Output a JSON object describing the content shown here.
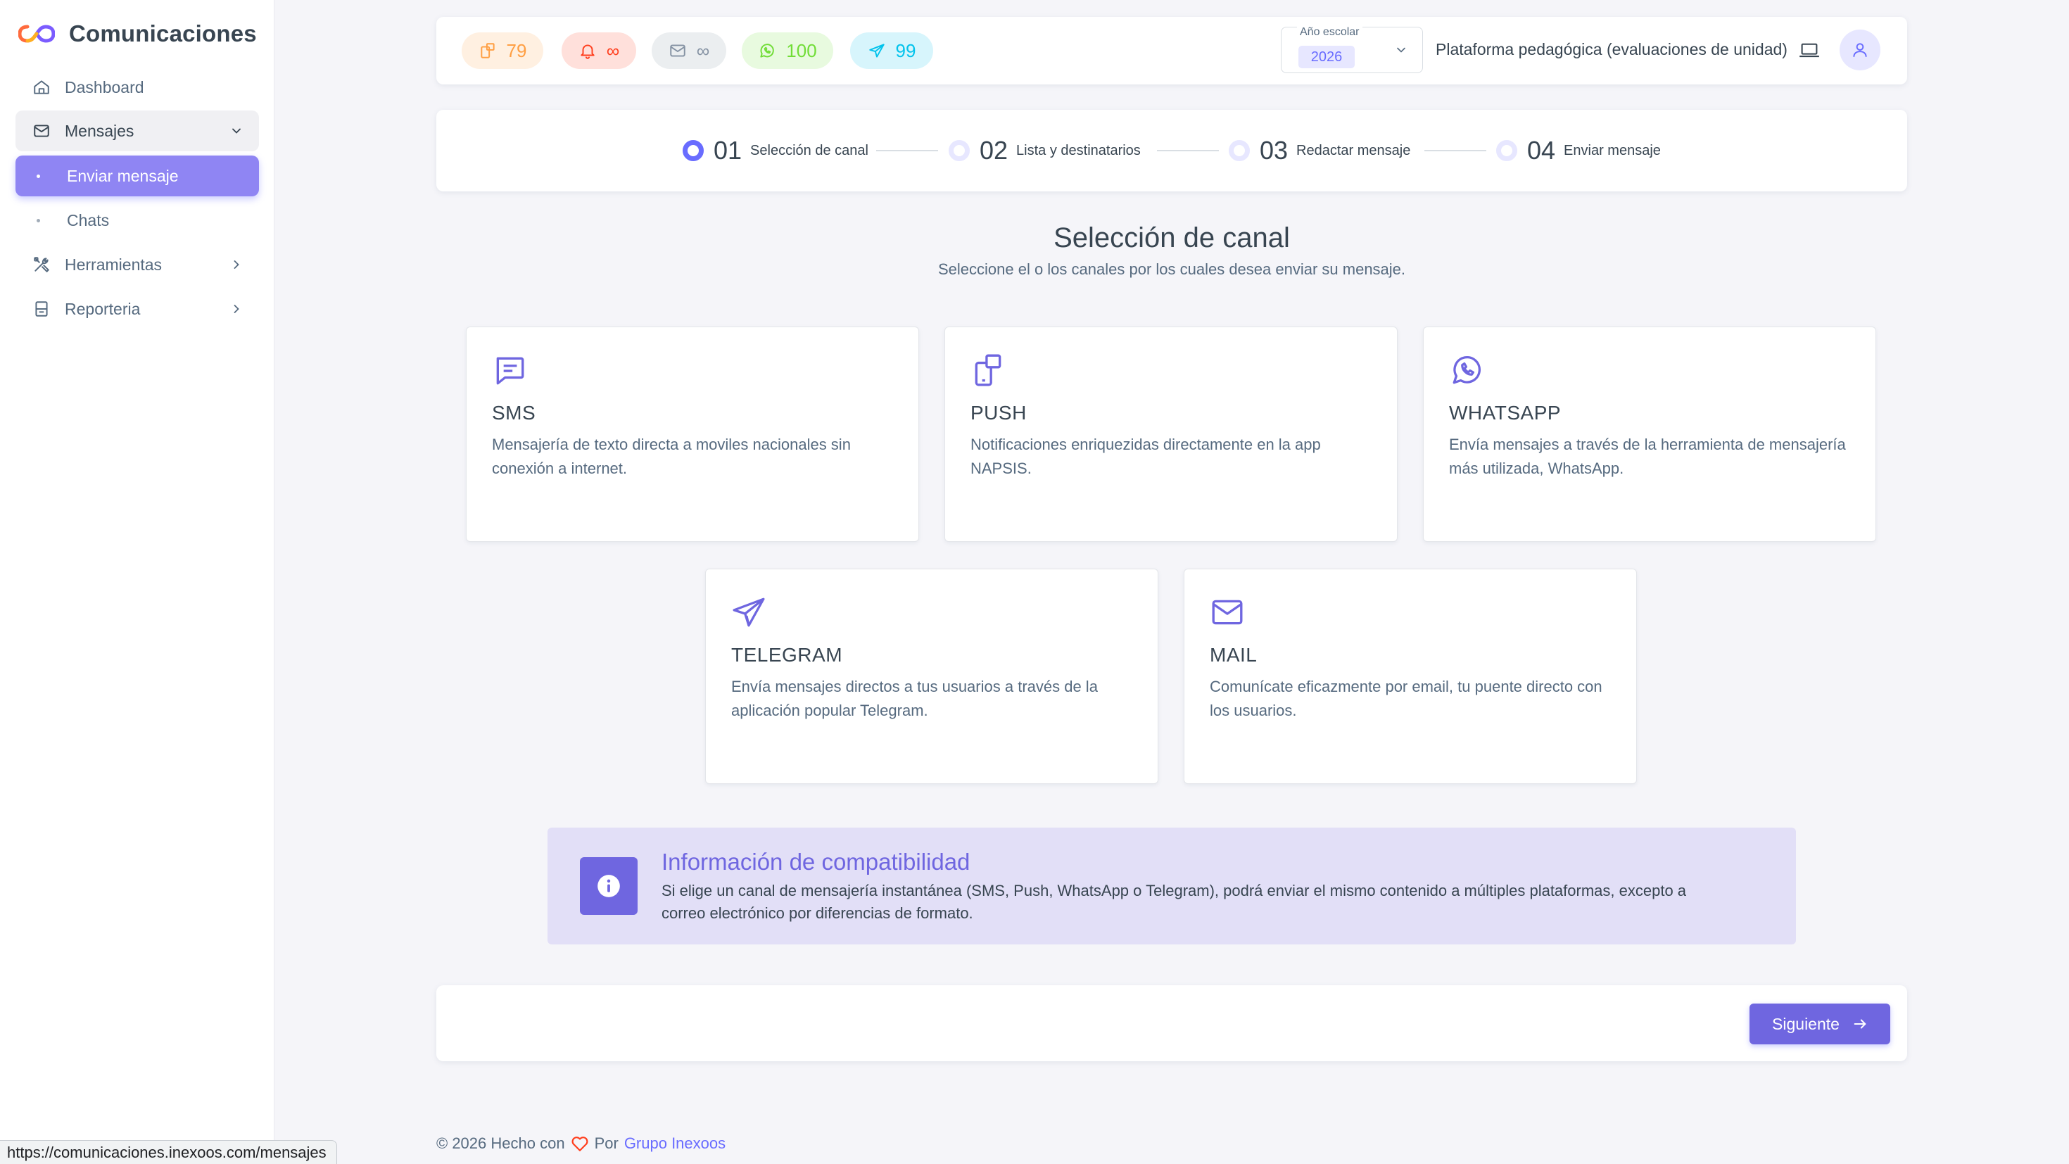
{
  "brand": {
    "title": "Comunicaciones",
    "icon": "infinity-logo-icon"
  },
  "sidebar": {
    "items": [
      {
        "label": "Dashboard",
        "icon": "home-icon"
      },
      {
        "label": "Mensajes",
        "icon": "mail-icon"
      },
      {
        "label": "Enviar mensaje"
      },
      {
        "label": "Chats"
      },
      {
        "label": "Herramientas",
        "icon": "tools-icon"
      },
      {
        "label": "Reporteria",
        "icon": "report-icon"
      }
    ]
  },
  "navbar": {
    "pills": [
      {
        "name": "push-counter",
        "value": "79",
        "icon": "push-icon",
        "color": "#ff9f43",
        "bg": "#fff0e1"
      },
      {
        "name": "notification-counter",
        "value": "∞",
        "icon": "bell-icon",
        "color": "#ff3e1d",
        "bg": "#ffe0db"
      },
      {
        "name": "mail-counter",
        "value": "∞",
        "icon": "mail-icon",
        "color": "#8592a3",
        "bg": "#ebeef0"
      },
      {
        "name": "whatsapp-counter",
        "value": "100",
        "icon": "whatsapp-icon",
        "color": "#71dd37",
        "bg": "#e8fadf"
      },
      {
        "name": "telegram-counter",
        "value": "99",
        "icon": "telegram-icon",
        "color": "#03c3ec",
        "bg": "#d7f5fc"
      }
    ],
    "year_label": "Año escolar",
    "year_value": "2026",
    "platform": "Plataforma pedagógica (evaluaciones de unidad)"
  },
  "stepper": {
    "steps": [
      {
        "num": "01",
        "label": "Selección de canal",
        "active": true
      },
      {
        "num": "02",
        "label": "Lista y destinatarios",
        "active": false
      },
      {
        "num": "03",
        "label": "Redactar mensaje",
        "active": false
      },
      {
        "num": "04",
        "label": "Enviar mensaje",
        "active": false
      }
    ]
  },
  "section": {
    "title": "Selección de canal",
    "subtitle": "Seleccione el o los canales por los cuales desea enviar su mensaje."
  },
  "channels": [
    {
      "title": "SMS",
      "desc": "Mensajería de texto directa a moviles nacionales sin conexión a internet.",
      "icon": "sms-icon"
    },
    {
      "title": "PUSH",
      "desc": "Notificaciones enriquezidas directamente en la app NAPSIS.",
      "icon": "push-icon"
    },
    {
      "title": "WHATSAPP",
      "desc": "Envía mensajes a través de la herramienta de mensajería más utilizada, WhatsApp.",
      "icon": "whatsapp-icon"
    },
    {
      "title": "TELEGRAM",
      "desc": "Envía mensajes directos a tus usuarios a través de la aplicación popular Telegram.",
      "icon": "telegram-icon"
    },
    {
      "title": "MAIL",
      "desc": "Comunícate eficazmente por email, tu puente directo con los usuarios.",
      "icon": "mail-icon"
    }
  ],
  "info": {
    "title": "Información de compatibilidad",
    "text": "Si elige un canal de mensajería instantánea (SMS, Push, WhatsApp o Telegram), podrá enviar el mismo contenido a múltiples plataformas, excepto a correo electrónico por diferencias de formato."
  },
  "actions": {
    "next_label": "Siguiente"
  },
  "footer": {
    "prefix": "© 2026 Hecho con",
    "by": "Por",
    "link": "Grupo Inexoos"
  },
  "status_url": "https://comunicaciones.inexoos.com/mensajes",
  "colors": {
    "accent": "#696cff",
    "active_menu": "#8f85f3",
    "info_bg": "#e2dff7"
  }
}
